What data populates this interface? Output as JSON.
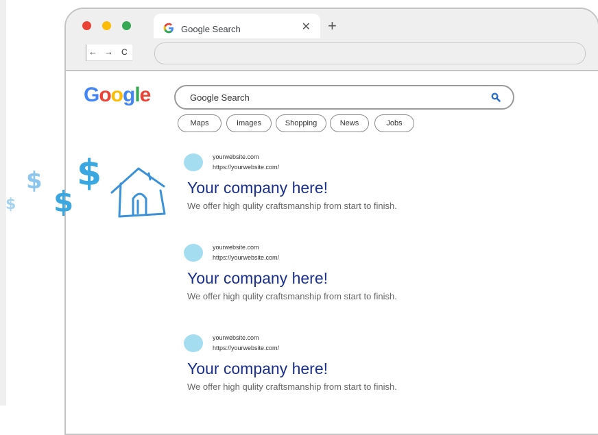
{
  "browser": {
    "tab_title": "Google Search",
    "tab_close": "✕",
    "new_tab": "+",
    "nav": {
      "back": "←",
      "forward": "→",
      "reload": "C"
    },
    "address_value": ""
  },
  "colors": {
    "red": "#ea4335",
    "yellow": "#fbbc05",
    "green": "#34a853",
    "blue": "#4285f4",
    "link": "#1a2f8c",
    "favicon": "#a5ddf0",
    "dollar": "#3ba7e0"
  },
  "google": {
    "logo": [
      "G",
      "o",
      "o",
      "g",
      "l",
      "e"
    ],
    "search_value": "Google Search"
  },
  "filters": [
    "Maps",
    "Images",
    "Shopping",
    "News",
    "Jobs"
  ],
  "results": [
    {
      "domain": "yourwebsite.com",
      "url": "https://yourwebsite.com/",
      "title": "Your company here!",
      "description": "We offer high qulity craftsmanship from start to finish."
    },
    {
      "domain": "yourwebsite.com",
      "url": "https://yourwebsite.com/",
      "title": "Your company here!",
      "description": "We offer high qulity craftsmanship from start to finish."
    },
    {
      "domain": "yourwebsite.com",
      "url": "https://yourwebsite.com/",
      "title": "Your company here!",
      "description": "We offer high qulity craftsmanship from start to finish."
    }
  ],
  "decoration": {
    "icons": [
      "dollar-sign-icon",
      "house-icon"
    ],
    "dollar_glyph": "$"
  }
}
